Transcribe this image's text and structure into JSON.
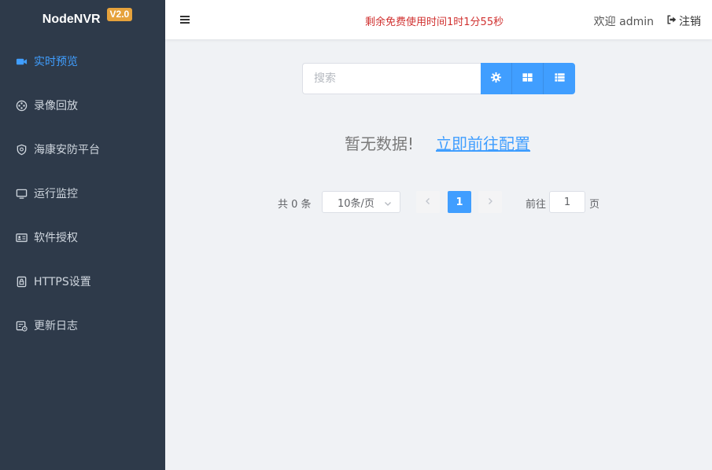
{
  "brand": {
    "name": "NodeNVR",
    "version": "V2.0"
  },
  "sidebar": {
    "items": [
      {
        "label": "实时预览",
        "icon": "video-camera-icon",
        "active": true
      },
      {
        "label": "录像回放",
        "icon": "film-reel-icon"
      },
      {
        "label": "海康安防平台",
        "icon": "shield-icon"
      },
      {
        "label": "运行监控",
        "icon": "monitor-icon"
      },
      {
        "label": "软件授权",
        "icon": "id-card-icon"
      },
      {
        "label": "HTTPS设置",
        "icon": "lock-file-icon"
      },
      {
        "label": "更新日志",
        "icon": "calendar-log-icon"
      }
    ]
  },
  "header": {
    "menu_icon": "hamburger-menu-icon",
    "trial_notice": "剩余免费使用时间1时1分55秒",
    "welcome": "欢迎 admin",
    "logout_label": "注销"
  },
  "toolbar": {
    "search_placeholder": "搜索",
    "search_value": "",
    "buttons": [
      "settings-gear-icon",
      "grid-view-icon",
      "list-view-icon"
    ]
  },
  "empty_state": {
    "text": "暂无数据!",
    "link": "立即前往配置"
  },
  "pagination": {
    "total_text": "共 0 条",
    "page_size": "10条/页",
    "current_page": "1",
    "goto_label": "前往",
    "goto_value": "1",
    "page_suffix": "页"
  },
  "colors": {
    "sidebar_bg": "#2e3a4a",
    "accent": "#409eff",
    "badge": "#e6a23c",
    "trial_text": "#d0302f",
    "content_bg": "#f0f2f5"
  }
}
